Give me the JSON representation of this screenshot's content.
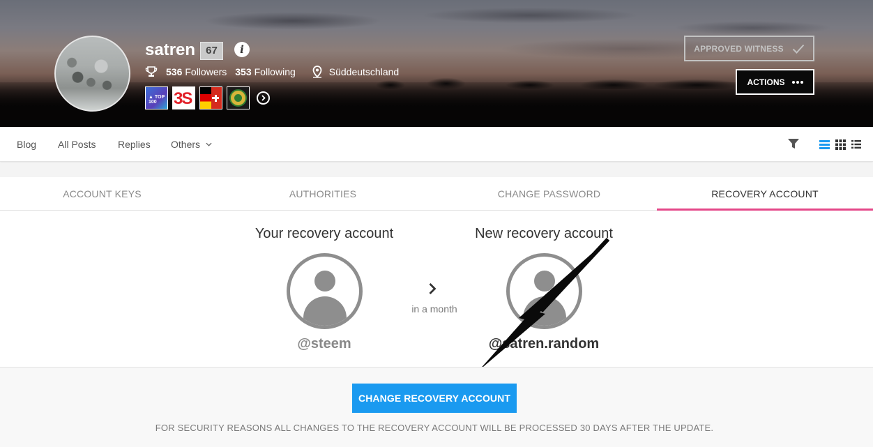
{
  "profile": {
    "username": "satren",
    "reputation": "67",
    "followers_count": "536",
    "followers_label": "Followers",
    "following_count": "353",
    "following_label": "Following",
    "location": "Süddeutschland",
    "badges": [
      "Top 100 badge",
      "3S badge",
      "Germany Switzerland flag badge",
      "Green gold emblem badge"
    ]
  },
  "header_actions": {
    "witness_label": "APPROVED WITNESS",
    "actions_label": "ACTIONS"
  },
  "nav": {
    "items": [
      "Blog",
      "All Posts",
      "Replies",
      "Others"
    ]
  },
  "tabs": [
    {
      "label": "ACCOUNT KEYS",
      "active": false
    },
    {
      "label": "AUTHORITIES",
      "active": false
    },
    {
      "label": "CHANGE PASSWORD",
      "active": false
    },
    {
      "label": "RECOVERY ACCOUNT",
      "active": true
    }
  ],
  "recovery": {
    "current_heading": "Your recovery account",
    "new_heading": "New recovery account",
    "transition_label": "in a month",
    "current_account": "@steem",
    "new_account": "@satren.random",
    "button_label": "CHANGE RECOVERY ACCOUNT",
    "notice": "FOR SECURITY REASONS ALL CHANGES TO THE RECOVERY ACCOUNT WILL BE PROCESSED 30 DAYS AFTER THE UPDATE."
  },
  "colors": {
    "accent_blue": "#1a9af0",
    "active_tab_underline": "#e44688",
    "placeholder_avatar": "#8e8e8e"
  },
  "icons": {
    "stats": "trophy-icon",
    "location": "map-pin-icon",
    "witness": "checkmark-icon",
    "actions": "ellipsis-icon",
    "others": "chevron-down-icon",
    "filter": "filter-icon",
    "views": [
      "view-list-icon",
      "view-grid-icon",
      "view-compact-icon"
    ],
    "transition": "chevron-right-icon"
  }
}
